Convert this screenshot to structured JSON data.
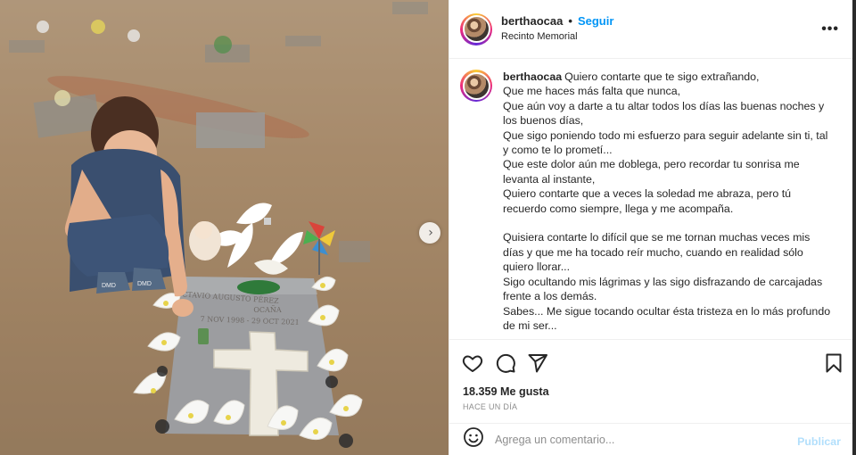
{
  "post": {
    "username": "berthaocaa",
    "separator": "•",
    "follow_label": "Seguir",
    "location": "Recinto Memorial",
    "more_label": "•••",
    "caption_username": "berthaocaa",
    "caption": "Quiero contarte que te sigo extrañando,\nQue me haces más falta que nunca,\nQue aún voy a darte a tu altar todos los días las buenas noches y los buenos días,\nQue sigo poniendo todo mi esfuerzo para seguir adelante sin ti, tal y como te lo prometí...\nQue este dolor aún me doblega, pero recordar tu sonrisa me levanta al instante,\nQuiero contarte que a veces la soledad me abraza, pero tú recuerdo como siempre, llega y me acompaña.\n\nQuisiera contarte lo difícil que se me tornan muchas veces mis días y que me ha tocado reír mucho, cuando en realidad sólo quiero llorar...\nSigo ocultando mis lágrimas y las sigo disfrazando de carcajadas frente a los demás.\nSabes... Me sigue tocando ocultar ésta tristeza en lo más profundo de mi ser...",
    "likes": "18.359 Me gusta",
    "time": "HACE UN DÍA",
    "comment_placeholder": "Agrega un comentario...",
    "publish_label": "Publicar"
  },
  "photo": {
    "plaque_line1": "OCTAVIO AUGUSTO PÉREZ",
    "plaque_line2": "OCAÑA",
    "plaque_line3": "7 NOV 1998 - 29 OCT 2021",
    "shoe_label_left": "DMD",
    "shoe_label_right": "DMD",
    "next_icon": "chevron-right-icon"
  },
  "icons": {
    "like": "heart-icon",
    "comment": "comment-bubble-icon",
    "share": "paper-plane-icon",
    "save": "bookmark-icon",
    "emoji": "emoji-smile-icon"
  }
}
